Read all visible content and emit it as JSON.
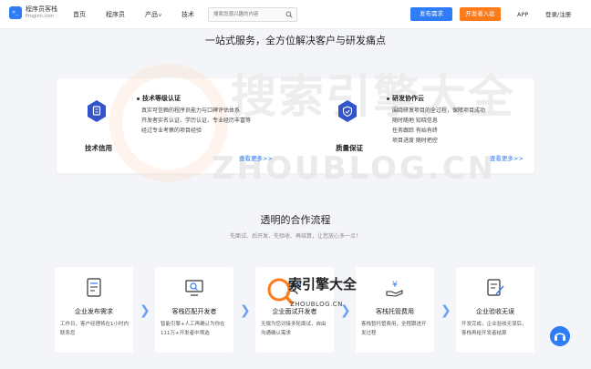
{
  "header": {
    "logo_cn": "程序员客栈",
    "logo_en": "Proginn.com",
    "logo_glyph": ">_",
    "nav": [
      {
        "label": "首页"
      },
      {
        "label": "程序员"
      },
      {
        "label": "产品",
        "has_caret": true
      },
      {
        "label": "技术"
      }
    ],
    "caret": "v",
    "search_placeholder": "搜索您感兴趣的内容",
    "post_button": "发布需求",
    "dev_button": "开发者入驻",
    "app_link": "APP",
    "login_link": "登录/注册"
  },
  "services": {
    "title": "一站式服务，全方位解决客户与研发痛点",
    "left": {
      "name": "技术信用",
      "heading": "技术等级认证",
      "lines": [
        "真实可信赖的程序员能力与口碑评估体系",
        "开发者实名认证、学历认证、专业经历丰富等",
        "经过专业考察的项目经验"
      ],
      "more": "查看更多>>"
    },
    "right": {
      "name": "质量保证",
      "heading": "研发协作云",
      "lines": [
        "围绕研发项目的全过程，保障项目成功",
        "随时随地 知晓信息",
        "任务跟踪 有始有终",
        "项目进度 随时把控"
      ],
      "more": "查看更多>>"
    }
  },
  "watermark": {
    "cn": "搜索引擎大全",
    "en": "ZHOUBLOG.CN",
    "small_cn": "索引擎大全",
    "small_en": "ZHOUBLOG.CN"
  },
  "process": {
    "title": "透明的合作流程",
    "subtitle": "先面试、后开发、先验收、再结算，让您放心多一点！",
    "steps": [
      {
        "title": "企业发布需求",
        "desc": "工作日，客户经理将在1小时内联系您"
      },
      {
        "title": "客栈匹配开发者",
        "desc": "智能引擎+人工再确认为你在111万+开发者中筛选"
      },
      {
        "title": "企业面试开发者",
        "desc": "无偿为您对接多轮面试，自由沟通确认需求"
      },
      {
        "title": "客栈托管费用",
        "desc": "客栈暂托管费用，全程跟进开发过程"
      },
      {
        "title": "企业验收无误",
        "desc": "开发完成，企业验收无误后，客栈再给开发者结算"
      }
    ],
    "arrow": "❯"
  },
  "colors": {
    "primary": "#2e7cf6",
    "accent": "#ff7a1a",
    "hex_icon": "#3353c9"
  }
}
